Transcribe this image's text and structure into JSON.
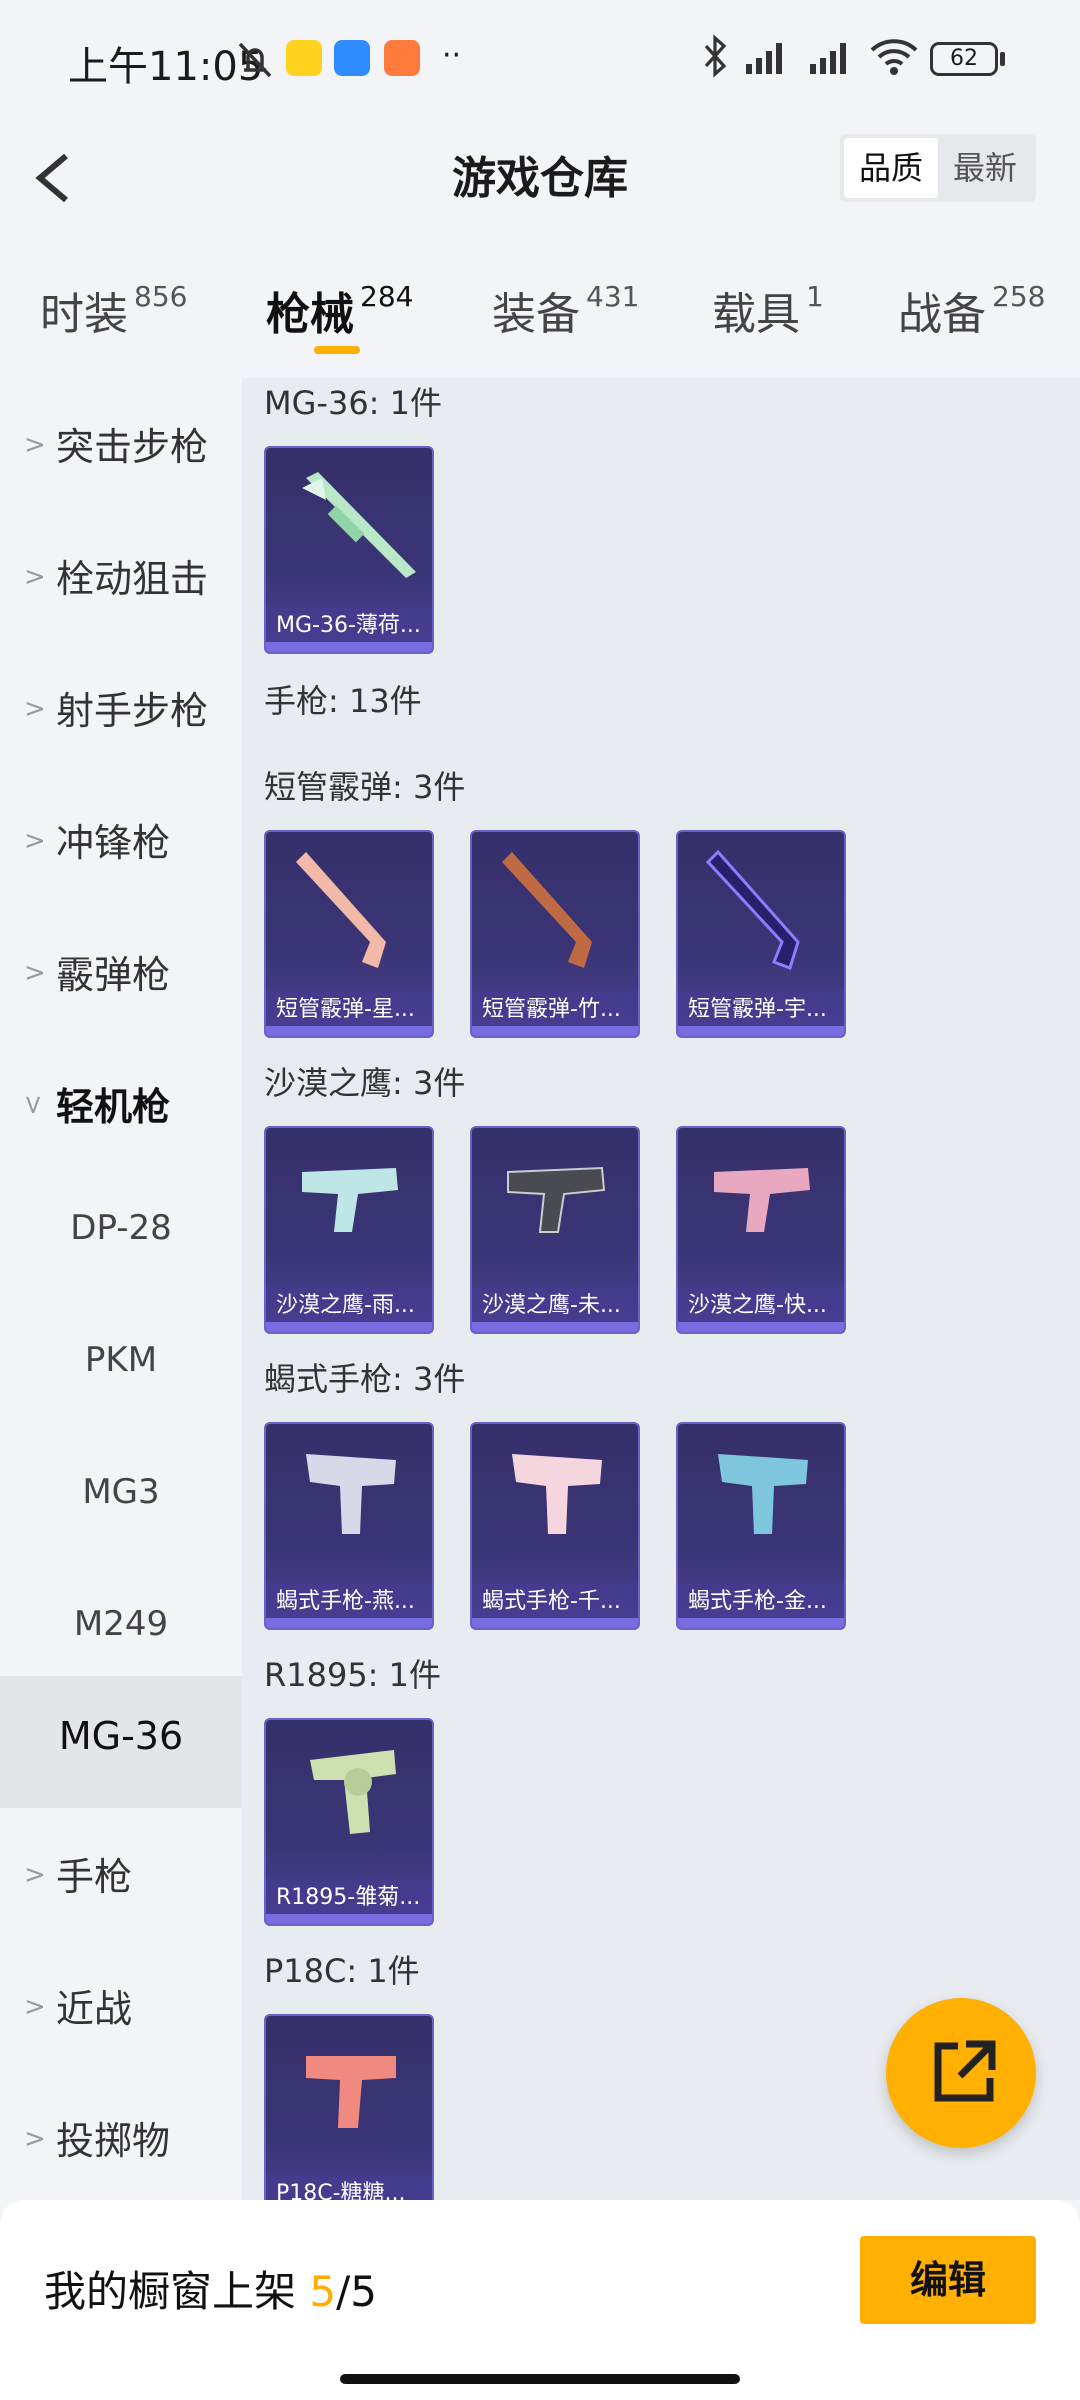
{
  "status": {
    "time": "上午11:05",
    "battery": "62",
    "network": "HD"
  },
  "header": {
    "title": "游戏仓库",
    "sort_quality": "品质",
    "sort_latest": "最新"
  },
  "tabs": [
    {
      "label": "时装",
      "count": "856"
    },
    {
      "label": "枪械",
      "count": "284"
    },
    {
      "label": "装备",
      "count": "431"
    },
    {
      "label": "载具",
      "count": "1"
    },
    {
      "label": "战备",
      "count": "258"
    }
  ],
  "sidebar": {
    "items": [
      {
        "label": "突击步枪"
      },
      {
        "label": "栓动狙击"
      },
      {
        "label": "射手步枪"
      },
      {
        "label": "冲锋枪"
      },
      {
        "label": "霰弹枪"
      },
      {
        "label": "轻机枪"
      },
      {
        "label": "DP-28"
      },
      {
        "label": "PKM"
      },
      {
        "label": "MG3"
      },
      {
        "label": "M249"
      },
      {
        "label": "MG-36"
      },
      {
        "label": "手枪"
      },
      {
        "label": "近战"
      },
      {
        "label": "投掷物"
      }
    ]
  },
  "sections": [
    {
      "title": "MG-36: 1件",
      "cards": [
        "MG-36-薄荷..."
      ]
    },
    {
      "title": "手枪: 13件",
      "cards": []
    },
    {
      "title": "短管霰弹: 3件",
      "cards": [
        "短管霰弹-星...",
        "短管霰弹-竹...",
        "短管霰弹-宇..."
      ]
    },
    {
      "title": "沙漠之鹰: 3件",
      "cards": [
        "沙漠之鹰-雨...",
        "沙漠之鹰-未...",
        "沙漠之鹰-快..."
      ]
    },
    {
      "title": "蝎式手枪: 3件",
      "cards": [
        "蝎式手枪-燕...",
        "蝎式手枪-千...",
        "蝎式手枪-金..."
      ]
    },
    {
      "title": "R1895: 1件",
      "cards": [
        "R1895-雏菊..."
      ]
    },
    {
      "title": "P18C: 1件",
      "cards": [
        "P18C-糖糖..."
      ]
    }
  ],
  "bottom": {
    "label": "我的橱窗上架 ",
    "current": "5",
    "sep": "/",
    "total": "5",
    "edit": "编辑"
  },
  "colors": {
    "accent": "#ffb000",
    "card": "#3b3577"
  }
}
